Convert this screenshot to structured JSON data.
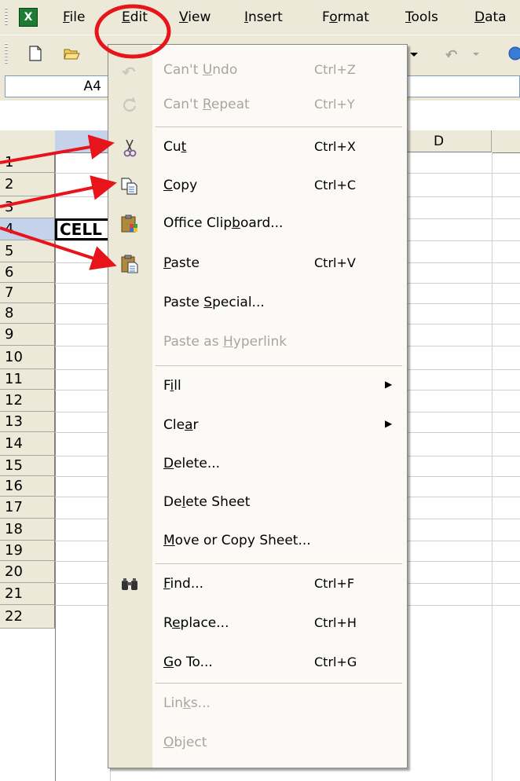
{
  "menubar": {
    "app_icon": "excel-app-icon",
    "app_icon_glyph": "X",
    "items": [
      {
        "label": "File",
        "accel": "F",
        "rest": "ile"
      },
      {
        "label": "Edit",
        "accel": "E",
        "rest": "dit"
      },
      {
        "label": "View",
        "accel": "V",
        "rest": "iew"
      },
      {
        "label": "Insert",
        "accel": "I",
        "rest": "nsert"
      },
      {
        "label": "Format",
        "pre": "F",
        "accel": "o",
        "rest": "rmat"
      },
      {
        "label": "Tools",
        "accel": "T",
        "rest": "ools"
      },
      {
        "label": "Data",
        "accel": "D",
        "rest": "ata"
      }
    ]
  },
  "toolbar": {
    "icons": [
      "new-document-icon",
      "open-folder-icon",
      "undo-icon",
      "dropdown-arrow-icon"
    ]
  },
  "namebox": {
    "value": "A4"
  },
  "grid": {
    "column_headers": [
      "D"
    ],
    "rows": [
      "1",
      "2",
      "3",
      "4",
      "5",
      "6",
      "7",
      "8",
      "9",
      "10",
      "11",
      "12",
      "13",
      "14",
      "15",
      "16",
      "17",
      "18",
      "19",
      "20",
      "21",
      "22"
    ],
    "cell_a4": "CELL"
  },
  "edit_menu": {
    "items": [
      {
        "pre": "Can't ",
        "accel": "U",
        "rest": "ndo",
        "shortcut": "Ctrl+Z",
        "enabled": false,
        "icon": "undo-icon"
      },
      {
        "pre": "Can't ",
        "accel": "R",
        "rest": "epeat",
        "shortcut": "Ctrl+Y",
        "enabled": false,
        "icon": "repeat-icon"
      },
      {
        "pre": "Cu",
        "accel": "t",
        "rest": "",
        "shortcut": "Ctrl+X",
        "enabled": true,
        "icon": "scissors-icon"
      },
      {
        "pre": "",
        "accel": "C",
        "rest": "opy",
        "shortcut": "Ctrl+C",
        "enabled": true,
        "icon": "copy-icon"
      },
      {
        "pre": "Office Clip",
        "accel": "b",
        "rest": "oard...",
        "shortcut": "",
        "enabled": true,
        "icon": "office-clipboard-icon"
      },
      {
        "pre": "",
        "accel": "P",
        "rest": "aste",
        "shortcut": "Ctrl+V",
        "enabled": true,
        "icon": "paste-icon"
      },
      {
        "pre": "Paste ",
        "accel": "S",
        "rest": "pecial...",
        "shortcut": "",
        "enabled": true,
        "icon": ""
      },
      {
        "pre": "Paste as ",
        "accel": "H",
        "rest": "yperlink",
        "shortcut": "",
        "enabled": false,
        "icon": ""
      },
      {
        "pre": "F",
        "accel": "i",
        "rest": "ll",
        "shortcut": "",
        "enabled": true,
        "icon": "",
        "submenu": true
      },
      {
        "pre": "Cle",
        "accel": "a",
        "rest": "r",
        "shortcut": "",
        "enabled": true,
        "icon": "",
        "submenu": true
      },
      {
        "pre": "",
        "accel": "D",
        "rest": "elete...",
        "shortcut": "",
        "enabled": true,
        "icon": ""
      },
      {
        "pre": "De",
        "accel": "l",
        "rest": "ete Sheet",
        "shortcut": "",
        "enabled": true,
        "icon": ""
      },
      {
        "pre": "",
        "accel": "M",
        "rest": "ove or Copy Sheet...",
        "shortcut": "",
        "enabled": true,
        "icon": ""
      },
      {
        "pre": "",
        "accel": "F",
        "rest": "ind...",
        "shortcut": "Ctrl+F",
        "enabled": true,
        "icon": "binoculars-icon"
      },
      {
        "pre": "R",
        "accel": "e",
        "rest": "place...",
        "shortcut": "Ctrl+H",
        "enabled": true,
        "icon": ""
      },
      {
        "pre": "",
        "accel": "G",
        "rest": "o To...",
        "shortcut": "Ctrl+G",
        "enabled": true,
        "icon": ""
      },
      {
        "pre": "Lin",
        "accel": "k",
        "rest": "s...",
        "shortcut": "",
        "enabled": false,
        "icon": ""
      },
      {
        "pre": "",
        "accel": "O",
        "rest": "bject",
        "shortcut": "",
        "enabled": false,
        "icon": ""
      }
    ]
  },
  "annotations": {
    "highlight_color": "#e8141c",
    "circle_target": "Edit menu",
    "arrow_targets": [
      "Cut",
      "Copy",
      "Paste"
    ]
  },
  "colors": {
    "chrome": "#ece9d8",
    "menu_bg": "#fbfaf6",
    "disabled_text": "#a7a69a",
    "annotation_red": "#e8141c"
  }
}
